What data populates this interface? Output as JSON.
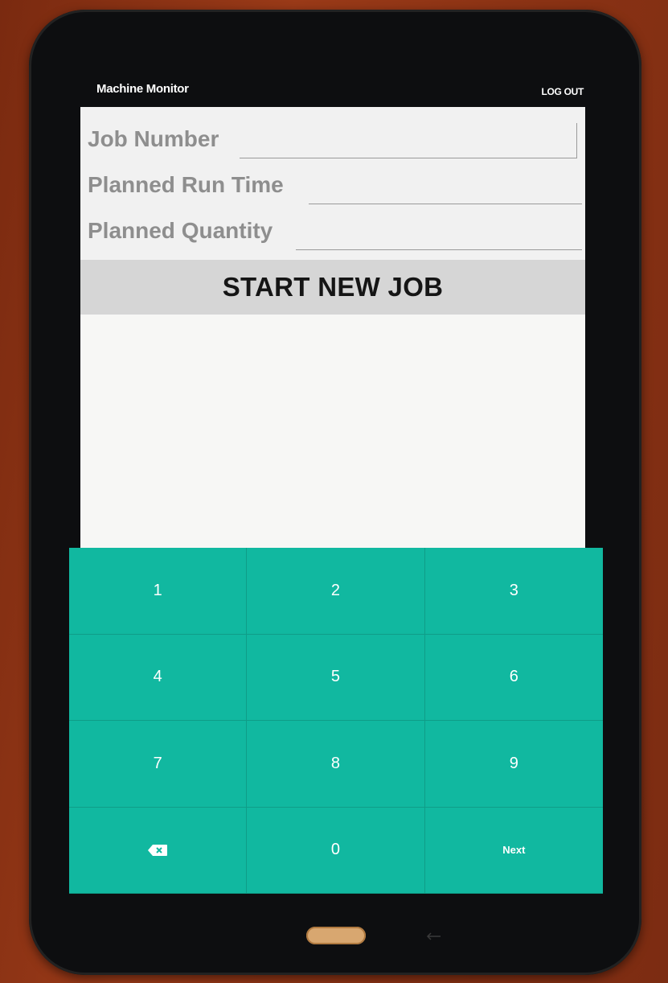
{
  "app": {
    "title": "Machine Monitor",
    "logout_label": "LOG OUT"
  },
  "form": {
    "fields": [
      {
        "label": "Job Number",
        "value": ""
      },
      {
        "label": "Planned Run Time",
        "value": ""
      },
      {
        "label": "Planned Quantity",
        "value": ""
      }
    ],
    "start_button_label": "START NEW JOB"
  },
  "keypad": {
    "keys": [
      "1",
      "2",
      "3",
      "4",
      "5",
      "6",
      "7",
      "8",
      "9",
      "backspace-icon",
      "0",
      "Next"
    ],
    "color": "#11b8a0"
  }
}
